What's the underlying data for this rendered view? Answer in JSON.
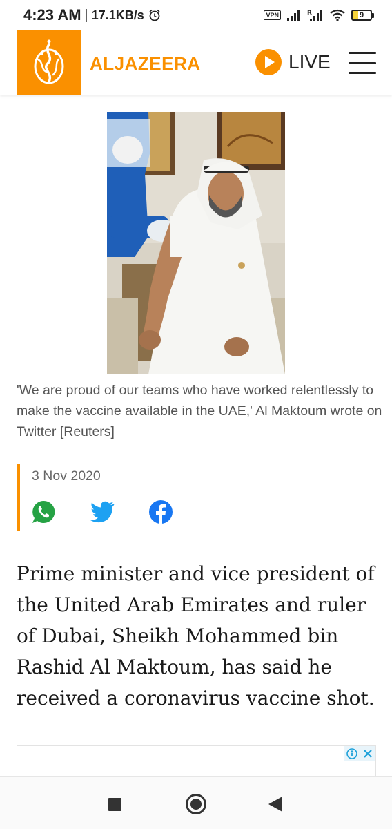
{
  "status_bar": {
    "time": "4:23 AM",
    "separator": "|",
    "net_speed": "17.1KB/s",
    "vpn": "VPN",
    "battery_level": "9",
    "icons": [
      "alarm-icon",
      "vpn-icon",
      "signal-icon",
      "roaming-signal-icon",
      "wifi-icon",
      "battery-icon"
    ]
  },
  "header": {
    "brand": "ALJAZEERA",
    "live_label": "LIVE",
    "accent_color": "#fa9000",
    "icons": [
      "aljazeera-logo",
      "live-play-icon",
      "hamburger-menu-icon"
    ]
  },
  "article": {
    "photo_caption": "'We are proud of our teams who have worked relentlessly to make the vaccine available in the UAE,' Al Maktoum wrote on Twitter [Reuters]",
    "date": "3 Nov 2020",
    "share": [
      {
        "name": "whatsapp",
        "icon": "whatsapp-icon",
        "color": "#25a244"
      },
      {
        "name": "twitter",
        "icon": "twitter-icon",
        "color": "#1da1f2"
      },
      {
        "name": "facebook",
        "icon": "facebook-icon",
        "color": "#1877f2"
      }
    ],
    "lead": "Prime minister and vice president of the United Arab Emirates and ruler of Dubai, Sheikh Mohammed bin Rashid Al Maktoum, has said he received a coronavirus vaccine shot."
  },
  "ad": {
    "icons": [
      "ad-info-icon",
      "ad-close-icon"
    ]
  },
  "nav_bar": {
    "icons": [
      "recents-square-icon",
      "home-circle-icon",
      "back-triangle-icon"
    ]
  }
}
